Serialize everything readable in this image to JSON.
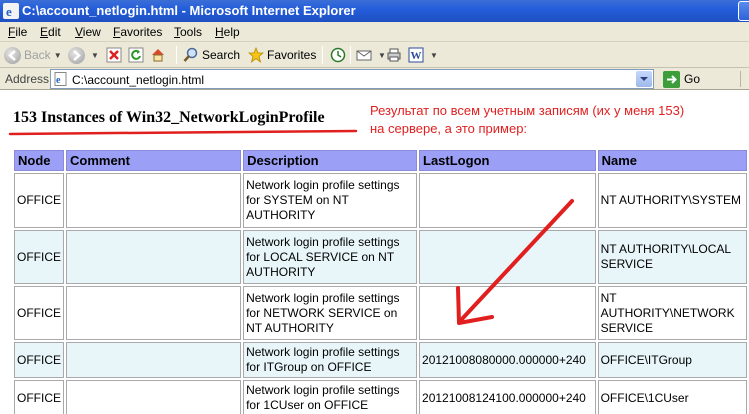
{
  "window": {
    "title": "C:\\account_netlogin.html - Microsoft Internet Explorer"
  },
  "menu": [
    "File",
    "Edit",
    "View",
    "Favorites",
    "Tools",
    "Help"
  ],
  "toolbar": {
    "back_label": "Back",
    "search_label": "Search",
    "favorites_label": "Favorites"
  },
  "address": {
    "label": "Address",
    "url": "C:\\account_netlogin.html",
    "go_label": "Go"
  },
  "page": {
    "heading": "153 Instances of Win32_NetworkLoginProfile",
    "annotation_line1": "Результат по всем учетным записям (их у меня 153)",
    "annotation_line2": "на сервере, а это пример:"
  },
  "table": {
    "headers": [
      "Node",
      "Comment",
      "Description",
      "LastLogon",
      "Name"
    ],
    "rows": [
      {
        "node": "OFFICE",
        "comment": "",
        "description": "Network login profile settings for SYSTEM on NT AUTHORITY",
        "lastlogon": "",
        "name": "NT AUTHORITY\\SYSTEM"
      },
      {
        "node": "OFFICE",
        "comment": "",
        "description": "Network login profile settings for LOCAL SERVICE on NT AUTHORITY",
        "lastlogon": "",
        "name": "NT AUTHORITY\\LOCAL SERVICE"
      },
      {
        "node": "OFFICE",
        "comment": "",
        "description": "Network login profile settings for NETWORK SERVICE on NT AUTHORITY",
        "lastlogon": "",
        "name": "NT AUTHORITY\\NETWORK SERVICE"
      },
      {
        "node": "OFFICE",
        "comment": "",
        "description": "Network login profile settings for ITGroup on OFFICE",
        "lastlogon": "20121008080000.000000+240",
        "name": "OFFICE\\ITGroup"
      },
      {
        "node": "OFFICE",
        "comment": "",
        "description": "Network login profile settings for 1CUser on OFFICE",
        "lastlogon": "20121008124100.000000+240",
        "name": "OFFICE\\1CUser"
      }
    ]
  },
  "colors": {
    "annotation": "#e11f1f",
    "header_bg": "#9b9ff5",
    "row_alt_bg": "#e8f6fa"
  },
  "icons": [
    "ie-icon",
    "back-icon",
    "forward-icon",
    "stop-icon",
    "refresh-icon",
    "home-icon",
    "search-icon",
    "favorites-star-icon",
    "mail-icon",
    "print-icon",
    "word-icon",
    "page-icon",
    "go-arrow-icon"
  ]
}
